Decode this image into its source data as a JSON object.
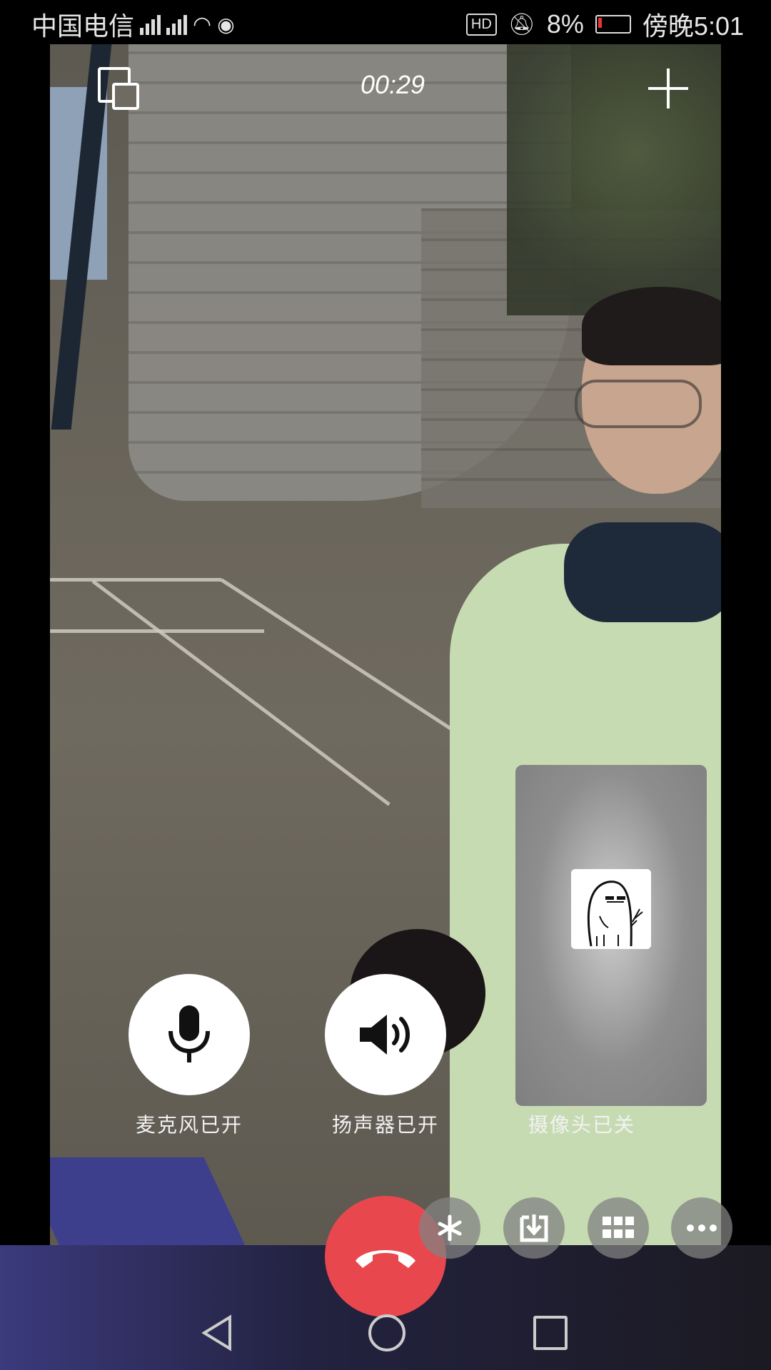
{
  "status_bar": {
    "carrier": "中国电信",
    "battery": "8%",
    "time": "傍晚5:01",
    "hd_badge": "HD"
  },
  "call": {
    "timer": "00:29",
    "controls": {
      "mic_label": "麦克风已开",
      "speaker_label": "扬声器已开",
      "camera_label": "摄像头已关"
    }
  },
  "icons": {
    "switch_view": "switch-window-icon",
    "add": "plus-icon",
    "mic": "microphone-icon",
    "speaker": "speaker-icon",
    "hangup": "phone-hangup-icon",
    "effects": "sparkle-icon",
    "download": "download-icon",
    "grid": "grid-icon",
    "more": "more-icon"
  },
  "colors": {
    "hangup": "#e8484d",
    "button_bg": "#ffffff"
  }
}
